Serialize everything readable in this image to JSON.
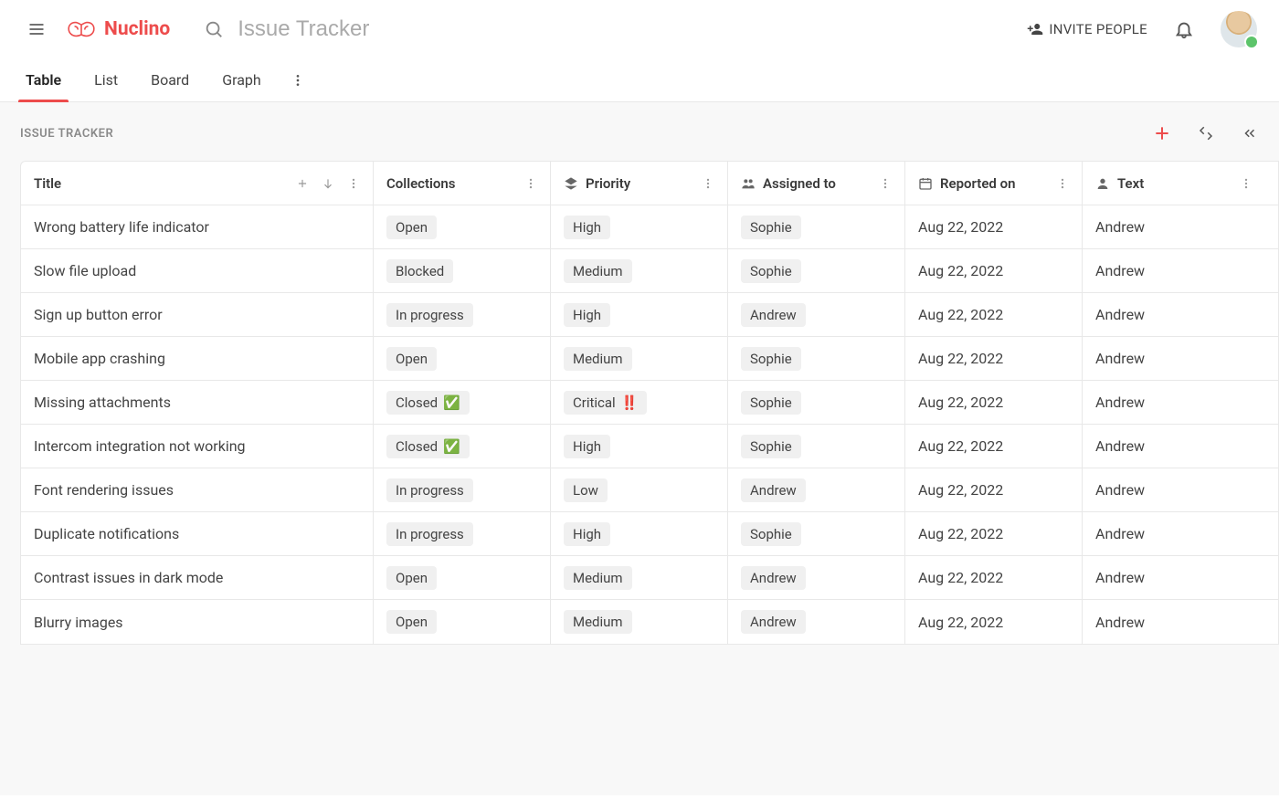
{
  "brand": {
    "name": "Nuclino"
  },
  "search": {
    "placeholder": "Issue Tracker"
  },
  "header": {
    "invite_label": "INVITE PEOPLE"
  },
  "tabs": [
    {
      "label": "Table",
      "active": true
    },
    {
      "label": "List",
      "active": false
    },
    {
      "label": "Board",
      "active": false
    },
    {
      "label": "Graph",
      "active": false
    }
  ],
  "breadcrumb": "ISSUE TRACKER",
  "columns": {
    "title": {
      "label": "Title"
    },
    "collections": {
      "label": "Collections"
    },
    "priority": {
      "label": "Priority"
    },
    "assigned": {
      "label": "Assigned to"
    },
    "reported": {
      "label": "Reported on"
    },
    "text": {
      "label": "Text"
    }
  },
  "rows": [
    {
      "title": "Wrong battery life indicator",
      "collection": "Open",
      "collection_emoji": "",
      "priority": "High",
      "priority_emoji": "",
      "assigned": "Sophie",
      "reported": "Aug 22, 2022",
      "text": "Andrew"
    },
    {
      "title": "Slow file upload",
      "collection": "Blocked",
      "collection_emoji": "",
      "priority": "Medium",
      "priority_emoji": "",
      "assigned": "Sophie",
      "reported": "Aug 22, 2022",
      "text": "Andrew"
    },
    {
      "title": "Sign up button error",
      "collection": "In progress",
      "collection_emoji": "",
      "priority": "High",
      "priority_emoji": "",
      "assigned": "Andrew",
      "reported": "Aug 22, 2022",
      "text": "Andrew"
    },
    {
      "title": "Mobile app crashing",
      "collection": "Open",
      "collection_emoji": "",
      "priority": "Medium",
      "priority_emoji": "",
      "assigned": "Sophie",
      "reported": "Aug 22, 2022",
      "text": "Andrew"
    },
    {
      "title": "Missing attachments",
      "collection": "Closed",
      "collection_emoji": "✅",
      "priority": "Critical",
      "priority_emoji": "‼️",
      "assigned": "Sophie",
      "reported": "Aug 22, 2022",
      "text": "Andrew"
    },
    {
      "title": "Intercom integration not working",
      "collection": "Closed",
      "collection_emoji": "✅",
      "priority": "High",
      "priority_emoji": "",
      "assigned": "Sophie",
      "reported": "Aug 22, 2022",
      "text": "Andrew"
    },
    {
      "title": "Font rendering issues",
      "collection": "In progress",
      "collection_emoji": "",
      "priority": "Low",
      "priority_emoji": "",
      "assigned": "Andrew",
      "reported": "Aug 22, 2022",
      "text": "Andrew"
    },
    {
      "title": "Duplicate notifications",
      "collection": "In progress",
      "collection_emoji": "",
      "priority": "High",
      "priority_emoji": "",
      "assigned": "Sophie",
      "reported": "Aug 22, 2022",
      "text": "Andrew"
    },
    {
      "title": "Contrast issues in dark mode",
      "collection": "Open",
      "collection_emoji": "",
      "priority": "Medium",
      "priority_emoji": "",
      "assigned": "Andrew",
      "reported": "Aug 22, 2022",
      "text": "Andrew"
    },
    {
      "title": "Blurry images",
      "collection": "Open",
      "collection_emoji": "",
      "priority": "Medium",
      "priority_emoji": "",
      "assigned": "Andrew",
      "reported": "Aug 22, 2022",
      "text": "Andrew"
    }
  ]
}
